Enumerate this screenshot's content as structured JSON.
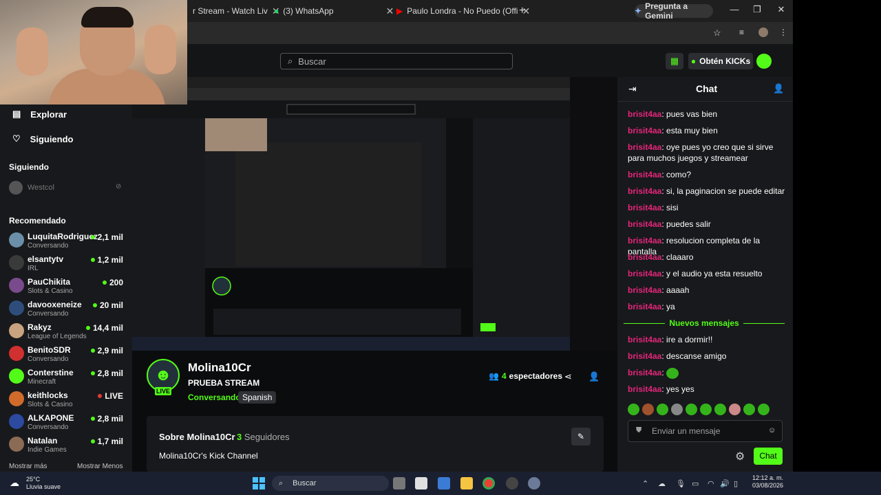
{
  "browser": {
    "tabs": [
      {
        "label": "r Stream - Watch Liv"
      },
      {
        "label": "(3) WhatsApp"
      },
      {
        "label": "Paulo Londra - No Puedo (Offi"
      }
    ],
    "gemini_label": "Pregunta a Gemini"
  },
  "header": {
    "search_placeholder": "Buscar",
    "get_kicks": "Obtén KICKs"
  },
  "sidebar": {
    "explore": "Explorar",
    "following_nav": "Siguiendo",
    "following_title": "Siguiendo",
    "following_channel": "Westcol",
    "recommended_title": "Recomendado",
    "recommended": [
      {
        "name": "LuquitaRodriguez",
        "category": "Conversando",
        "viewers": "2,1 mil",
        "color": "#6b8fa8"
      },
      {
        "name": "elsantytv",
        "category": "IRL",
        "viewers": "1,2 mil",
        "color": "#3a3a3a"
      },
      {
        "name": "PauChikita",
        "category": "Slots & Casino",
        "viewers": "200",
        "color": "#7a4b8c"
      },
      {
        "name": "davooxeneize",
        "category": "Conversando",
        "viewers": "20 mil",
        "color": "#2e4d7a"
      },
      {
        "name": "Rakyz",
        "category": "League of Legends",
        "viewers": "14,4 mil",
        "color": "#c9a27f"
      },
      {
        "name": "BenitoSDR",
        "category": "Conversando",
        "viewers": "2,9 mil",
        "color": "#d03030"
      },
      {
        "name": "Conterstine",
        "category": "Minecraft",
        "viewers": "2,8 mil",
        "color": "#53fc18"
      },
      {
        "name": "keithlocks",
        "category": "Slots & Casino",
        "viewers": "LIVE",
        "color": "#d06b2b"
      },
      {
        "name": "ALKAPONE",
        "category": "Conversando",
        "viewers": "2,8 mil",
        "color": "#2b4aa0"
      },
      {
        "name": "Natalan",
        "category": "Indie Games",
        "viewers": "1,7 mil",
        "color": "#8c6b55"
      }
    ],
    "show_more": "Mostrar más",
    "show_less": "Mostrar Menos"
  },
  "stream": {
    "channel": "Molina10Cr",
    "title": "PRUEBA STREAM",
    "category": "Conversando",
    "language": "Spanish",
    "live_badge": "LIVE",
    "viewers_count": "4",
    "viewers_label": "espectadores",
    "about_title": "Sobre Molina10Cr",
    "followers_count": "3",
    "followers_label": "Seguidores",
    "about_desc": "Molina10Cr's Kick Channel"
  },
  "chat": {
    "title": "Chat",
    "messages": [
      {
        "user": "brisit4aa",
        "text": "pues vas bien"
      },
      {
        "user": "brisit4aa",
        "text": "esta muy bien"
      },
      {
        "user": "brisit4aa",
        "text": "oye pues yo creo que si sirve para muchos juegos y streamear"
      },
      {
        "user": "brisit4aa",
        "text": "como?"
      },
      {
        "user": "brisit4aa",
        "text": "si, la paginacion se puede editar"
      },
      {
        "user": "brisit4aa",
        "text": "sisi"
      },
      {
        "user": "brisit4aa",
        "text": "puedes salir"
      },
      {
        "user": "brisit4aa",
        "text": "resolucion completa de la pantalla"
      },
      {
        "user": "brisit4aa",
        "text": "claaaro"
      },
      {
        "user": "brisit4aa",
        "text": "y el audio ya esta resuelto"
      },
      {
        "user": "brisit4aa",
        "text": "aaaah"
      },
      {
        "user": "brisit4aa",
        "text": "ya"
      }
    ],
    "new_messages_label": "Nuevos mensajes",
    "new_messages": [
      {
        "user": "brisit4aa",
        "text": "ire a dormir!!"
      },
      {
        "user": "brisit4aa",
        "text": "descanse amigo"
      },
      {
        "user": "brisit4aa",
        "text": ""
      },
      {
        "user": "brisit4aa",
        "text": "yes yes"
      }
    ],
    "input_placeholder": "Enviar un mensaje",
    "send_label": "Chat"
  },
  "taskbar": {
    "temperature": "25°C",
    "weather": "Lluvia suave",
    "search": "Buscar",
    "time": "12:12 a. m.",
    "date": "03/08/2026"
  }
}
